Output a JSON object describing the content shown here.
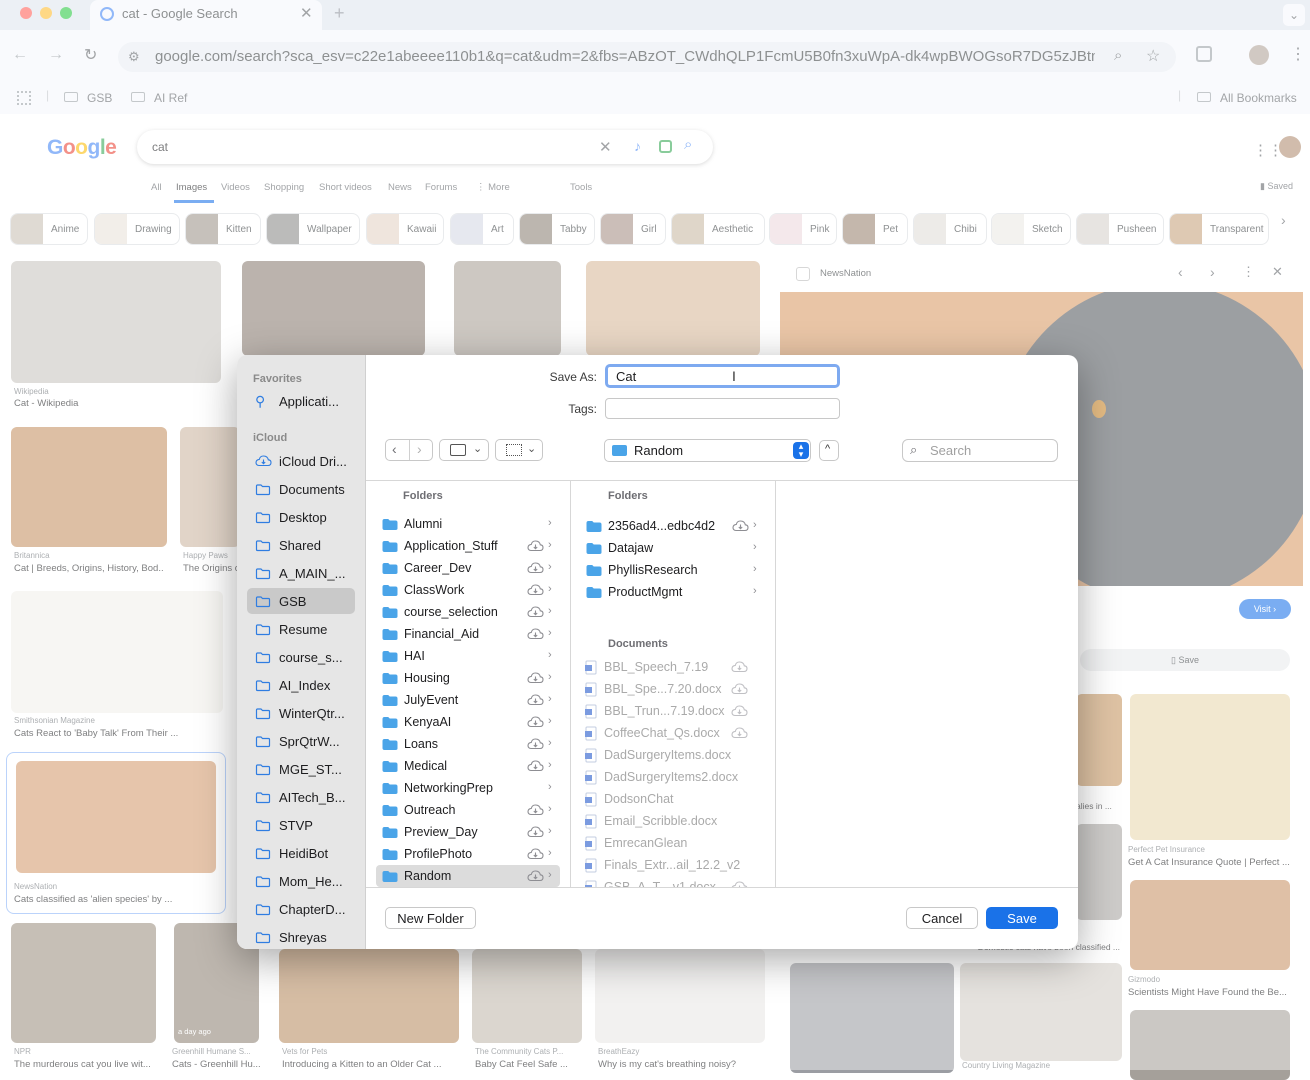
{
  "browser": {
    "tab_title": "cat - Google Search",
    "url": "google.com/search?sca_esv=c22e1abeeee110b1&q=cat&udm=2&fbs=ABzOT_CWdhQLP1FcmU5B0fn3xuWpA-dk4wpBWOGsoR7DG5zJBtmu...",
    "bookmarks": [
      "GSB",
      "AI Ref"
    ],
    "all_bookmarks": "All Bookmarks"
  },
  "google": {
    "logo": "Google",
    "query": "cat",
    "tabs": [
      "All",
      "Images",
      "Videos",
      "Shopping",
      "Short videos",
      "News",
      "Forums",
      "⋮ More",
      "Tools"
    ],
    "saved": "Saved",
    "chips": [
      "Anime",
      "Drawing",
      "Kitten",
      "Wallpaper",
      "Kawaii",
      "Art",
      "Tabby",
      "Girl",
      "Aesthetic",
      "Pink",
      "Pet",
      "Chibi",
      "Sketch",
      "Pusheen",
      "Transparent"
    ],
    "results": [
      {
        "source": "Wikipedia",
        "caption": "Cat - Wikipedia"
      },
      {
        "source": "Britannica",
        "caption": "Cat | Breeds, Origins, History, Bod..."
      },
      {
        "source": "Happy Paws",
        "caption": "The Origins c"
      },
      {
        "source": "Smithsonian Magazine",
        "caption": "Cats React to 'Baby Talk' From Their ..."
      },
      {
        "source": "NewsNation",
        "caption": "Cats classified as 'alien species' by ..."
      },
      {
        "source": "NPR",
        "caption": "The murderous cat you live wit..."
      },
      {
        "source": "Greenhill Humane S...",
        "caption": "Cats - Greenhill Hu..."
      },
      {
        "source": "Vets for Pets",
        "caption": "Introducing a Kitten to an Older Cat ..."
      },
      {
        "source": "The Community Cats P...",
        "caption": "Baby Cat Feel Safe ..."
      },
      {
        "source": "BreathEazy",
        "caption": "Why is my cat's breathing noisy?"
      },
      {
        "source": "Perfect Pet Insurance",
        "caption": "Get A Cat Insurance Quote | Perfect ..."
      },
      {
        "source": "Gizmodo",
        "caption": "Scientists Might Have Found the Be..."
      },
      {
        "source": "Country Living Magazine",
        "caption": ""
      }
    ],
    "badge_day_ago": "a day ago",
    "partial_captions": [
      "alies in ...",
      "Domestic cats have been classified ..."
    ],
    "panel": {
      "source": "NewsNation",
      "visit": "Visit",
      "save": "Save"
    }
  },
  "dialog": {
    "save_as_label": "Save As:",
    "save_as_value": "Cat",
    "tags_label": "Tags:",
    "tags_value": "",
    "location": "Random",
    "search_placeholder": "Search",
    "sidebar": {
      "favorites_header": "Favorites",
      "favorites": [
        "Applicati..."
      ],
      "icloud_header": "iCloud",
      "items": [
        "iCloud Dri...",
        "Documents",
        "Desktop",
        "Shared",
        "A_MAIN_...",
        "GSB",
        "Resume",
        "course_s...",
        "AI_Index",
        "WinterQtr...",
        "SprQtrW...",
        "MGE_ST...",
        "AITech_B...",
        "STVP",
        "HeidiBot",
        "Mom_He...",
        "ChapterD...",
        "Shreyas"
      ],
      "selected": "GSB"
    },
    "col1_header": "Folders",
    "col1": [
      "Alumni",
      "Application_Stuff",
      "Career_Dev",
      "ClassWork",
      "course_selection",
      "Financial_Aid",
      "HAI",
      "Housing",
      "JulyEvent",
      "KenyaAI",
      "Loans",
      "Medical",
      "NetworkingPrep",
      "Outreach",
      "Preview_Day",
      "ProfilePhoto",
      "Random"
    ],
    "col1_selected": "Random",
    "col2_folders_header": "Folders",
    "col2_folders": [
      "2356ad4...edbc4d2",
      "Datajaw",
      "PhyllisResearch",
      "ProductMgmt"
    ],
    "col2_docs_header": "Documents",
    "col2_docs": [
      "BBL_Speech_7.19",
      "BBL_Spe...7.20.docx",
      "BBL_Trun...7.19.docx",
      "CoffeeChat_Qs.docx",
      "DadSurgeryItems.docx",
      "DadSurgeryItems2.docx",
      "DodsonChat",
      "Email_Scribble.docx",
      "EmrecanGlean",
      "Finals_Extr...ail_12.2_v2",
      "GSB_A_T....v1.docx"
    ],
    "new_folder": "New Folder",
    "cancel": "Cancel",
    "save": "Save"
  },
  "colors": {
    "accent": "#1a73e8",
    "save_button": "#1a72e8",
    "folder": "#4aa4e8"
  }
}
